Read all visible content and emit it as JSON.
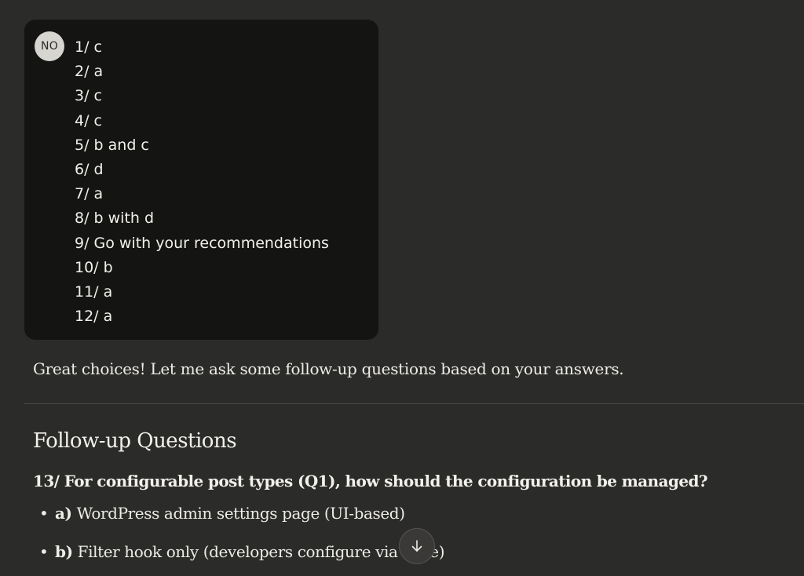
{
  "user_message": {
    "avatar_initials": "NO",
    "answers": [
      "1/ c",
      "2/ a",
      "3/ c",
      "4/ c",
      "5/ b and c",
      "6/ d",
      "7/ a",
      "8/ b with d",
      "9/ Go with your recommendations",
      "10/ b",
      "11/ a",
      "12/ a"
    ]
  },
  "assistant_response": {
    "intro": "Great choices! Let me ask some follow-up questions based on your answers.",
    "heading": "Follow-up Questions",
    "question": "13/ For configurable post types (Q1), how should the configuration be managed?",
    "options": [
      {
        "bullet": "•",
        "key": "a)",
        "text": " WordPress admin settings page (UI-based)"
      },
      {
        "bullet": "•",
        "key": "b)",
        "text": " Filter hook only (developers configure via code)"
      }
    ]
  },
  "scroll_button": {
    "icon": "arrow-down-icon",
    "color": "#eeece6"
  },
  "colors": {
    "background": "#2b2b2a",
    "bubble": "#141413",
    "avatar": "#d7d5cf",
    "text": "#eeece6"
  }
}
